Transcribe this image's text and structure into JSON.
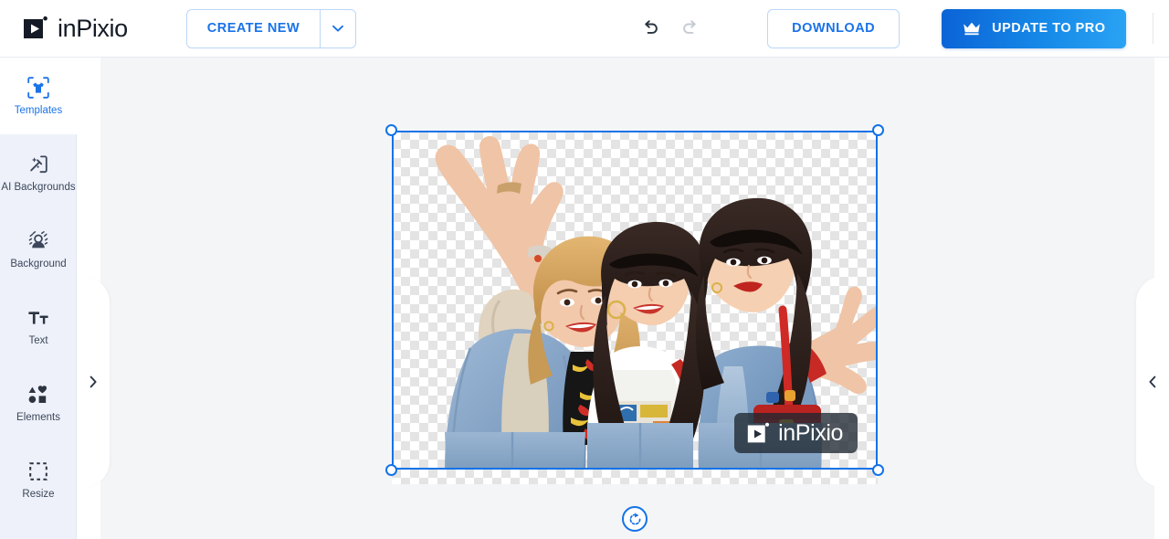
{
  "app": {
    "name": "inPixio",
    "logo_icon": "inpixio-play-logo"
  },
  "header": {
    "create_new_label": "CREATE NEW",
    "create_new_caret_icon": "chevron-down-icon",
    "undo_icon": "undo-arrow-icon",
    "redo_icon": "redo-arrow-icon",
    "download_label": "DOWNLOAD",
    "update_pro_label": "UPDATE TO PRO",
    "update_pro_icon": "crown-icon",
    "avatar_icon": "user-account-icon",
    "avatar_badge": "notification-dot",
    "accent_blue": "#1a73e8",
    "pro_gradient_from": "#0b63d6",
    "pro_gradient_to": "#2aa3f4",
    "badge_red": "#e8232a"
  },
  "sidebar": {
    "items": [
      {
        "label": "Templates",
        "icon": "tshirt-frame-icon",
        "active": true
      },
      {
        "label": "AI Backgrounds",
        "icon": "magic-wand-icon",
        "active": false
      },
      {
        "label": "Background",
        "icon": "portrait-cutout-icon",
        "active": false
      },
      {
        "label": "Text",
        "icon": "text-tt-icon",
        "active": false
      },
      {
        "label": "Elements",
        "icon": "shapes-icon",
        "active": false
      },
      {
        "label": "Resize",
        "icon": "dashed-square-icon",
        "active": false
      }
    ],
    "background": "#eef1fa",
    "active_color": "#1a73e8"
  },
  "panels": {
    "left_toggle_icon": "chevron-right-icon",
    "right_toggle_icon": "chevron-left-icon"
  },
  "canvas": {
    "background": "#f4f5f7",
    "transparency_checker": true,
    "selection": {
      "color": "#1273e8",
      "handles": [
        "top-left",
        "top-right",
        "bottom-left",
        "bottom-right"
      ],
      "rotate_icon": "rotate-icon"
    },
    "image": {
      "subject": "three-women-denim-photo",
      "alpha": "cut-out-transparent-background"
    },
    "watermark": {
      "text": "inPixio",
      "icon": "inpixio-play-logo"
    }
  }
}
